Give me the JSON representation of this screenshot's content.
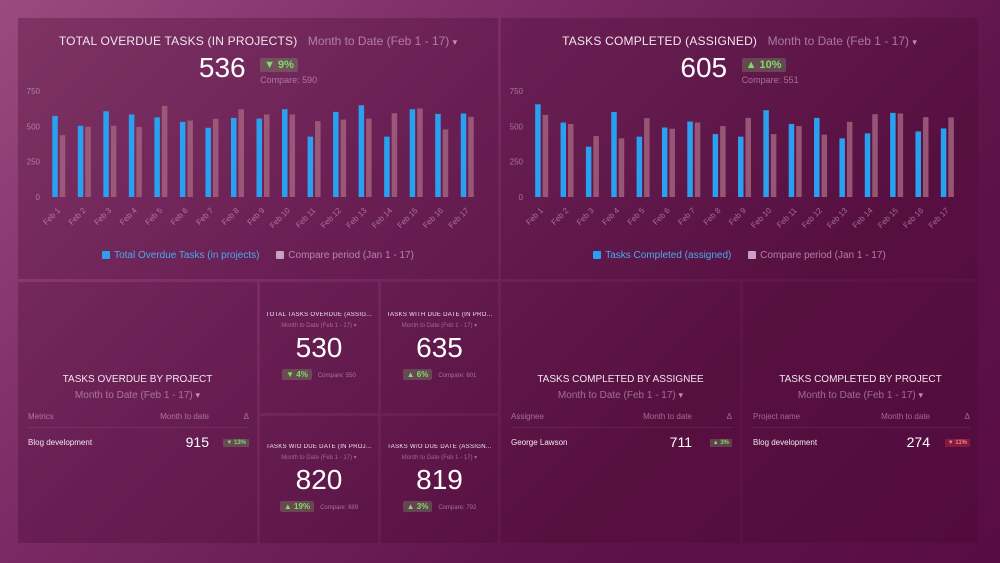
{
  "colors": {
    "primary": "#2aa0f0",
    "compare": "#a2617f",
    "positive": "#7fdc6a",
    "negative": "#ff7070"
  },
  "overdue_chart": {
    "title": "TOTAL OVERDUE TASKS (IN PROJECTS)",
    "range": "Month to Date (Feb 1 - 17)",
    "value": "536",
    "delta": "▼ 9%",
    "compare": "Compare: 590",
    "legend": {
      "primary": "Total Overdue Tasks (in projects)",
      "compare": "Compare period (Jan 1 - 17)"
    }
  },
  "completed_chart": {
    "title": "TASKS COMPLETED (ASSIGNED)",
    "range": "Month to Date (Feb 1 - 17)",
    "value": "605",
    "delta": "▲ 10%",
    "compare": "Compare: 551",
    "legend": {
      "primary": "Tasks Completed (assigned)",
      "compare": "Compare period (Jan 1 - 17)"
    }
  },
  "chart_data": [
    {
      "type": "bar",
      "title": "TOTAL OVERDUE TASKS (IN PROJECTS)",
      "categories": [
        "Feb 1",
        "Feb 2",
        "Feb 3",
        "Feb 4",
        "Feb 5",
        "Feb 6",
        "Feb 7",
        "Feb 8",
        "Feb 9",
        "Feb 10",
        "Feb 11",
        "Feb 12",
        "Feb 13",
        "Feb 14",
        "Feb 15",
        "Feb 16",
        "Feb 17"
      ],
      "series": [
        {
          "name": "Total Overdue Tasks (in projects)",
          "values": [
            574,
            504,
            607,
            584,
            563,
            532,
            490,
            560,
            555,
            621,
            427,
            602,
            649,
            427,
            621,
            588,
            591
          ]
        },
        {
          "name": "Compare period (Jan 1 - 17)",
          "values": [
            438,
            497,
            504,
            495,
            645,
            541,
            553,
            621,
            584,
            584,
            537,
            548,
            555,
            593,
            626,
            478,
            567
          ]
        }
      ],
      "yticks": [
        0,
        250,
        500,
        750
      ],
      "ylim": [
        0,
        750
      ],
      "grid": false,
      "legend": "bottom"
    },
    {
      "type": "bar",
      "title": "TASKS COMPLETED (ASSIGNED)",
      "categories": [
        "Feb 1",
        "Feb 2",
        "Feb 3",
        "Feb 4",
        "Feb 5",
        "Feb 6",
        "Feb 7",
        "Feb 8",
        "Feb 9",
        "Feb 10",
        "Feb 11",
        "Feb 12",
        "Feb 13",
        "Feb 14",
        "Feb 15",
        "Feb 16",
        "Feb 17"
      ],
      "series": [
        {
          "name": "Tasks Completed (assigned)",
          "values": [
            656,
            527,
            356,
            602,
            427,
            492,
            534,
            445,
            427,
            614,
            516,
            560,
            415,
            450,
            595,
            464,
            485
          ]
        },
        {
          "name": "Compare period (Jan 1 - 17)",
          "values": [
            581,
            516,
            431,
            415,
            558,
            483,
            527,
            502,
            560,
            445,
            502,
            441,
            532,
            586,
            591,
            565,
            563
          ]
        }
      ],
      "yticks": [
        0,
        250,
        500,
        750
      ],
      "ylim": [
        0,
        750
      ],
      "grid": false,
      "legend": "bottom"
    }
  ],
  "overdue_by_project": {
    "title": "TASKS OVERDUE BY PROJECT",
    "range": "Month to Date (Feb 1 - 17)",
    "headers": [
      "Metrics",
      "Month to date",
      "Δ"
    ],
    "rows": [
      {
        "name": "Blog development",
        "value": "915",
        "delta": "▼ 13%"
      }
    ]
  },
  "tiles": [
    {
      "title": "TOTAL TASKS OVERDUE (ASSIG...",
      "range": "Month to Date (Feb 1 - 17)",
      "value": "530",
      "delta": "▼ 4%",
      "compare": "Compare: 550"
    },
    {
      "title": "TASKS WITH DUE DATE (IN PRO...",
      "range": "Month to Date (Feb 1 - 17)",
      "value": "635",
      "delta": "▲ 6%",
      "compare": "Compare: 601"
    },
    {
      "title": "TASKS W/O DUE DATE (IN PROJ...",
      "range": "Month to Date (Feb 1 - 17)",
      "value": "820",
      "delta": "▲ 19%",
      "compare": "Compare: 689"
    },
    {
      "title": "TASKS W/O DUE DATE (ASSIGN...",
      "range": "Month to Date (Feb 1 - 17)",
      "value": "819",
      "delta": "▲ 3%",
      "compare": "Compare: 792"
    }
  ],
  "completed_by_assignee": {
    "title": "TASKS COMPLETED BY ASSIGNEE",
    "range": "Month to Date (Feb 1 - 17)",
    "headers": [
      "Assignee",
      "Month to date",
      "Δ"
    ],
    "rows": [
      {
        "name": "George Lawson",
        "value": "711",
        "delta": "▲ 3%"
      }
    ]
  },
  "completed_by_project": {
    "title": "TASKS COMPLETED BY PROJECT",
    "range": "Month to Date (Feb 1 - 17)",
    "headers": [
      "Project name",
      "Month to date",
      "Δ"
    ],
    "rows": [
      {
        "name": "Blog development",
        "value": "274",
        "delta": "▼ 11%"
      }
    ]
  },
  "chevron": "⌄"
}
